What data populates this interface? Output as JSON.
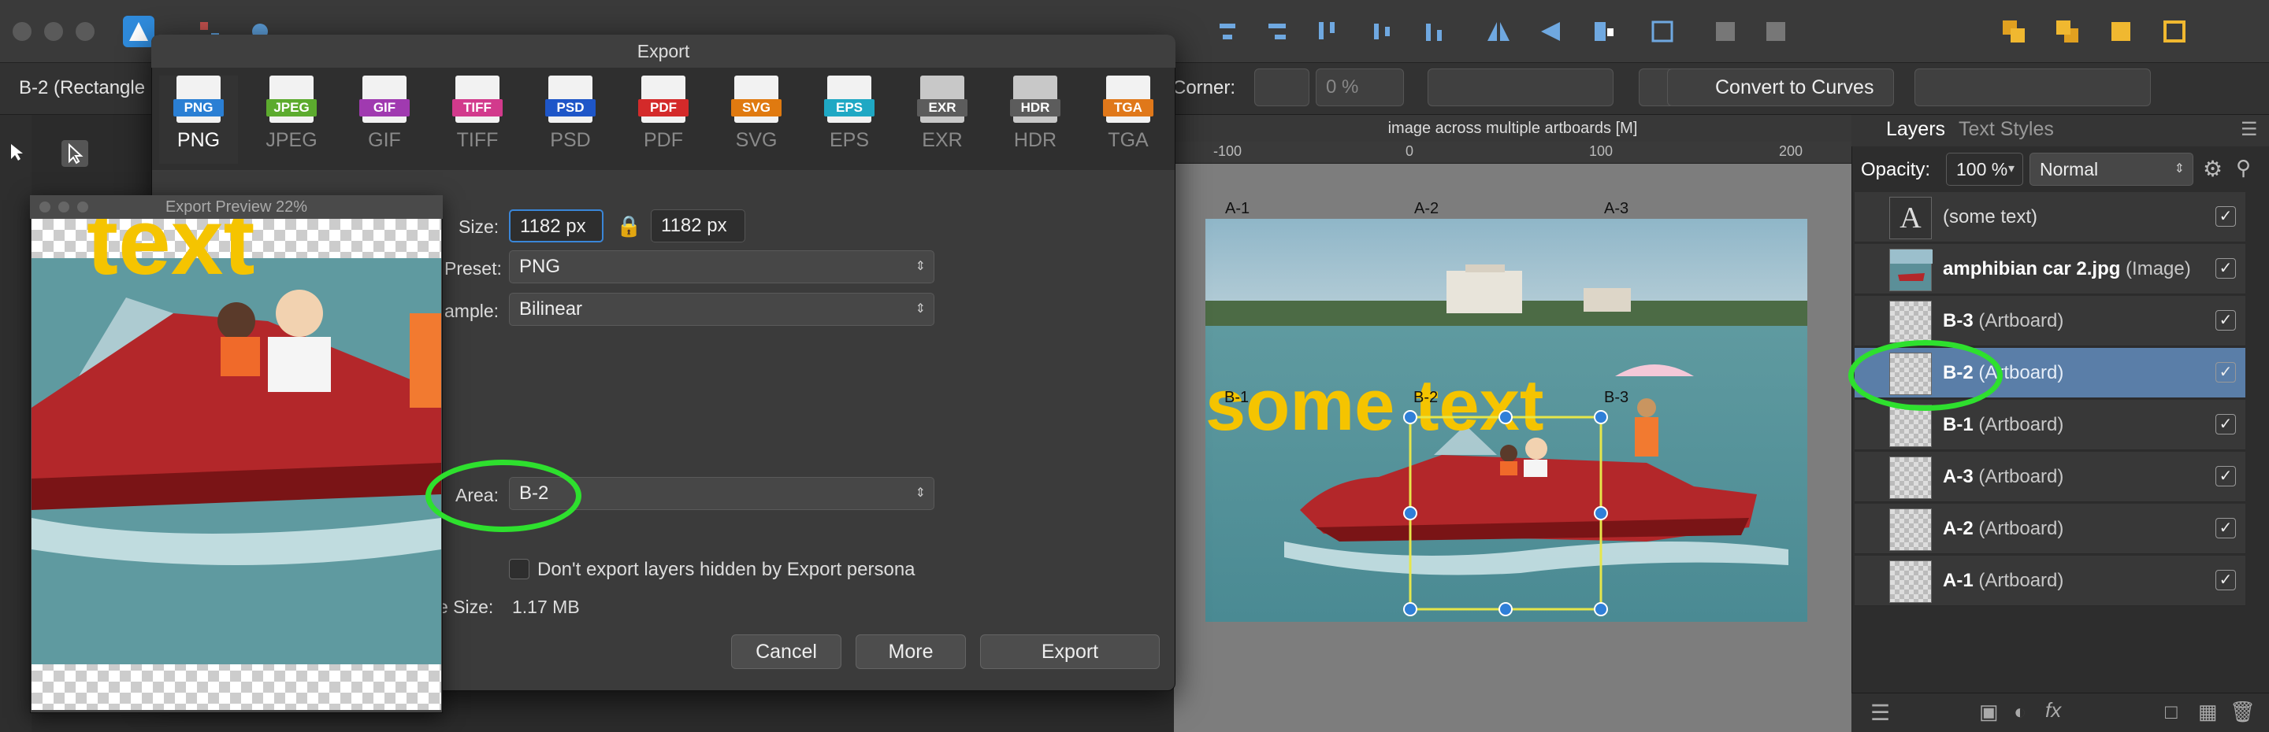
{
  "toolbar": {
    "accent": "#2f8bdc"
  },
  "context": {
    "selection_label": "B-2 (Rectangle",
    "corner_label": "Corner:",
    "corner_value": "0 %",
    "convert_label": "Convert to Curves"
  },
  "document": {
    "title": "image across multiple artboards [M]",
    "ruler_ticks": [
      "-100",
      "0",
      "100",
      "200"
    ],
    "artboards_top": [
      "A-1",
      "A-2",
      "A-3"
    ],
    "artboards_mid": [
      "B-1",
      "B-2",
      "B-3"
    ],
    "photo_text": "some text"
  },
  "layers": {
    "tabs": [
      "Layers",
      "Text Styles"
    ],
    "opacity_label": "Opacity:",
    "opacity_value": "100 %",
    "blend_mode": "Normal",
    "items": [
      {
        "name": "(some text)",
        "kind": "",
        "thumb": "A"
      },
      {
        "name": "amphibian car 2.jpg",
        "kind": " (Image)",
        "thumb": "img"
      },
      {
        "name": "B-3",
        "kind": " (Artboard)",
        "thumb": ""
      },
      {
        "name": "B-2",
        "kind": " (Artboard)",
        "thumb": "",
        "selected": true
      },
      {
        "name": "B-1",
        "kind": " (Artboard)",
        "thumb": ""
      },
      {
        "name": "A-3",
        "kind": " (Artboard)",
        "thumb": ""
      },
      {
        "name": "A-2",
        "kind": " (Artboard)",
        "thumb": ""
      },
      {
        "name": "A-1",
        "kind": " (Artboard)",
        "thumb": ""
      }
    ]
  },
  "export": {
    "title": "Export",
    "formats": [
      {
        "id": "PNG",
        "color": "#2a7fd4"
      },
      {
        "id": "JPEG",
        "color": "#5cab2e"
      },
      {
        "id": "GIF",
        "color": "#a03ab0"
      },
      {
        "id": "TIFF",
        "color": "#d23a8c"
      },
      {
        "id": "PSD",
        "color": "#1e56c8"
      },
      {
        "id": "PDF",
        "color": "#d42a2a"
      },
      {
        "id": "SVG",
        "color": "#e07a10"
      },
      {
        "id": "EPS",
        "color": "#1fa8c4"
      },
      {
        "id": "EXR",
        "color": "#5c5c5c"
      },
      {
        "id": "HDR",
        "color": "#5c5c5c"
      },
      {
        "id": "TGA",
        "color": "#e0781a"
      }
    ],
    "selected_format": "PNG",
    "size_label": "Size:",
    "width": "1182 px",
    "height": "1182 px",
    "preset_label": "Preset:",
    "preset_value": "PNG",
    "resample_label": "ample:",
    "resample_value": "Bilinear",
    "area_label": "Area:",
    "area_value": "B-2",
    "hidden_layers_label": "Don't export layers hidden by Export persona",
    "filesize_label": "e Size:",
    "filesize_value": "1.17 MB",
    "buttons": {
      "cancel": "Cancel",
      "more": "More",
      "export": "Export"
    }
  },
  "preview": {
    "title": "Export Preview 22%",
    "photo_text": "text"
  },
  "colors": {
    "highlight": "#2ee02e",
    "selection": "#5a7ea8",
    "text_yellow": "#f5c400"
  }
}
